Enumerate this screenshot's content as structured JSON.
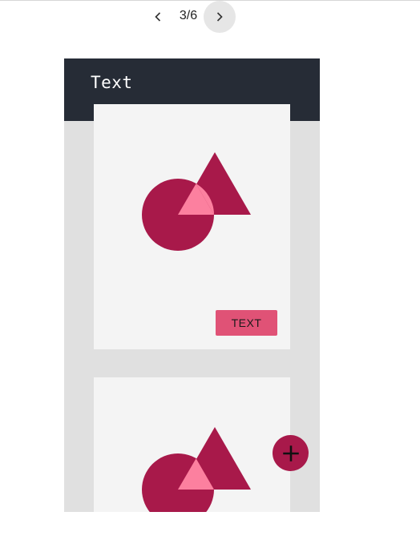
{
  "pager": {
    "counter": "3/6",
    "prev_icon": "chevron-left-icon",
    "next_icon": "chevron-right-icon"
  },
  "app": {
    "title": "Text",
    "colors": {
      "appbar": "#262c36",
      "background": "#e0e0e0",
      "card": "#f4f4f4",
      "primary": "#a8194a",
      "primary_light": "#fc809f",
      "button": "#e05276"
    }
  },
  "cards": [
    {
      "image_icon": "shapes-illustration-icon",
      "action_label": "TEXT"
    },
    {
      "image_icon": "shapes-illustration-icon"
    }
  ],
  "fab": {
    "icon": "plus-icon"
  }
}
